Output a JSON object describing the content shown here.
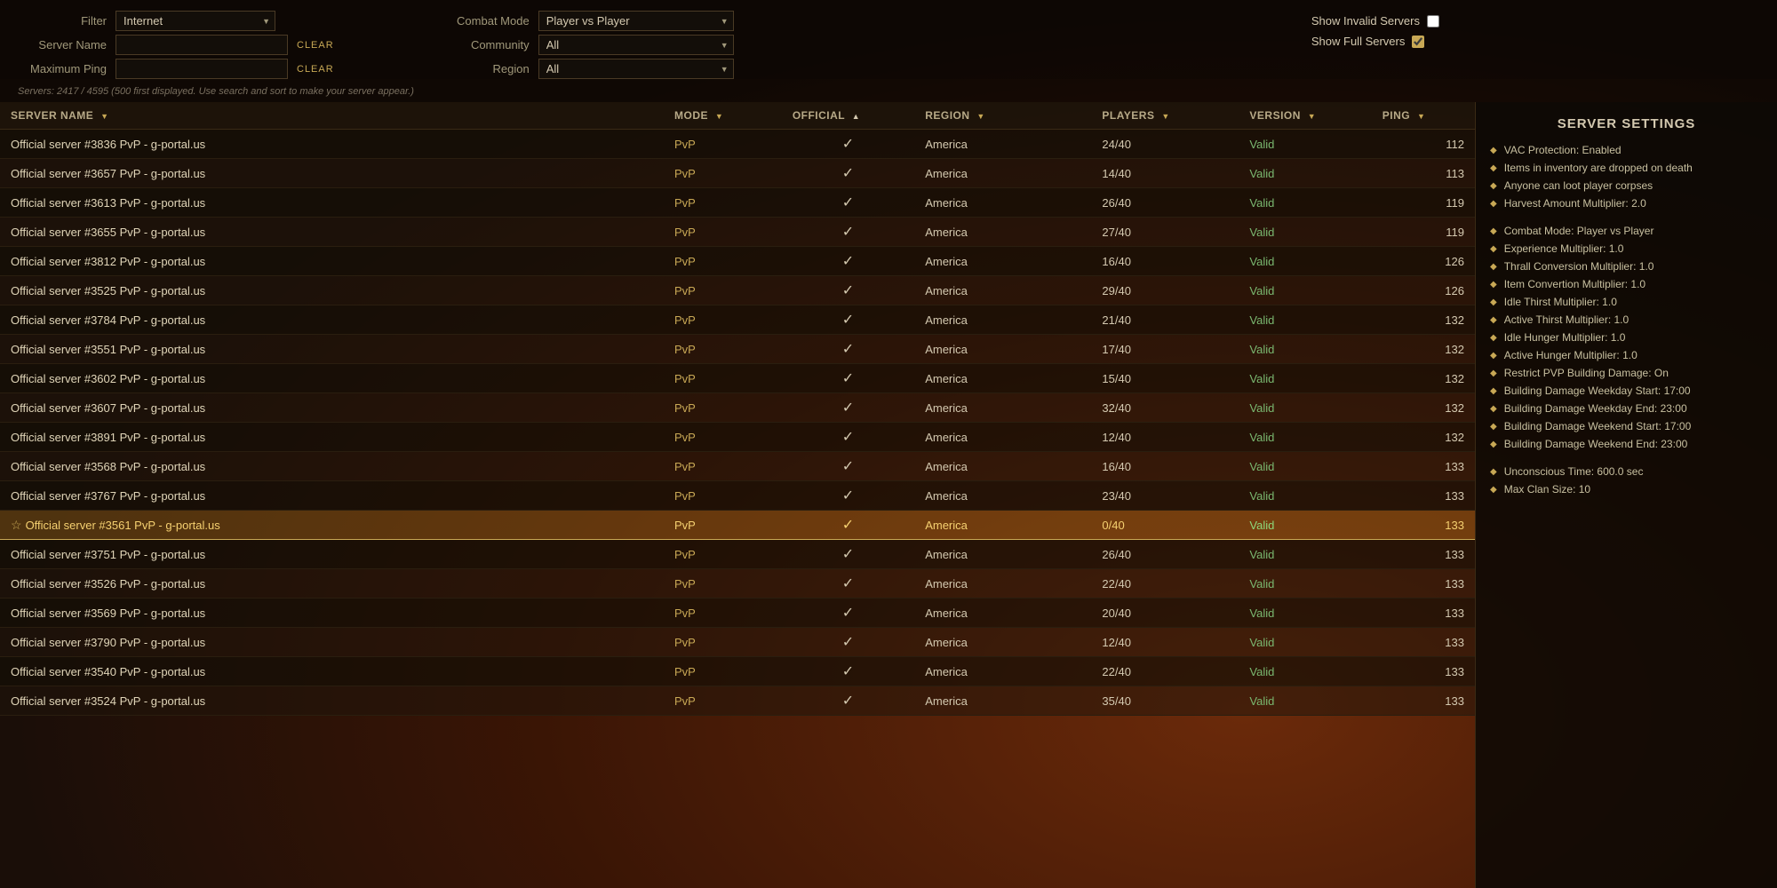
{
  "filters": {
    "filter_label": "Filter",
    "filter_value": "Internet",
    "server_name_label": "Server Name",
    "server_name_placeholder": "",
    "server_name_clear": "CLEAR",
    "max_ping_label": "Maximum Ping",
    "max_ping_placeholder": "",
    "max_ping_clear": "CLEAR",
    "combat_mode_label": "Combat Mode",
    "combat_mode_value": "Player vs Player",
    "community_label": "Community",
    "community_value": "All",
    "region_label": "Region",
    "region_value": "All",
    "show_invalid_label": "Show Invalid Servers",
    "show_full_label": "Show Full Servers",
    "show_invalid_checked": false,
    "show_full_checked": true
  },
  "server_count": {
    "text": "Servers: 2417 / 4595 (500 first displayed. Use search and sort to make your server appear.)"
  },
  "table": {
    "headers": [
      {
        "label": "SERVER NAME",
        "sort": "▼",
        "col": "server-name"
      },
      {
        "label": "MODE",
        "sort": "▼",
        "col": "mode"
      },
      {
        "label": "OFFICIAL",
        "sort": "▲",
        "col": "official"
      },
      {
        "label": "REGION",
        "sort": "▼",
        "col": "region"
      },
      {
        "label": "PLAYERS",
        "sort": "▼",
        "col": "players"
      },
      {
        "label": "VERSION",
        "sort": "▼",
        "col": "version"
      },
      {
        "label": "PING",
        "sort": "▼",
        "col": "ping"
      }
    ],
    "rows": [
      {
        "name": "Official server #3836 PvP - g-portal.us",
        "mode": "PvP",
        "official": "✓",
        "region": "America",
        "players": "24/40",
        "version": "Valid",
        "ping": "112",
        "selected": false,
        "star": false
      },
      {
        "name": "Official server #3657 PvP - g-portal.us",
        "mode": "PvP",
        "official": "✓",
        "region": "America",
        "players": "14/40",
        "version": "Valid",
        "ping": "113",
        "selected": false,
        "star": false
      },
      {
        "name": "Official server #3613 PvP - g-portal.us",
        "mode": "PvP",
        "official": "✓",
        "region": "America",
        "players": "26/40",
        "version": "Valid",
        "ping": "119",
        "selected": false,
        "star": false
      },
      {
        "name": "Official server #3655 PvP - g-portal.us",
        "mode": "PvP",
        "official": "✓",
        "region": "America",
        "players": "27/40",
        "version": "Valid",
        "ping": "119",
        "selected": false,
        "star": false
      },
      {
        "name": "Official server #3812 PvP - g-portal.us",
        "mode": "PvP",
        "official": "✓",
        "region": "America",
        "players": "16/40",
        "version": "Valid",
        "ping": "126",
        "selected": false,
        "star": false
      },
      {
        "name": "Official server #3525 PvP - g-portal.us",
        "mode": "PvP",
        "official": "✓",
        "region": "America",
        "players": "29/40",
        "version": "Valid",
        "ping": "126",
        "selected": false,
        "star": false
      },
      {
        "name": "Official server #3784 PvP - g-portal.us",
        "mode": "PvP",
        "official": "✓",
        "region": "America",
        "players": "21/40",
        "version": "Valid",
        "ping": "132",
        "selected": false,
        "star": false
      },
      {
        "name": "Official server #3551 PvP - g-portal.us",
        "mode": "PvP",
        "official": "✓",
        "region": "America",
        "players": "17/40",
        "version": "Valid",
        "ping": "132",
        "selected": false,
        "star": false
      },
      {
        "name": "Official server #3602 PvP - g-portal.us",
        "mode": "PvP",
        "official": "✓",
        "region": "America",
        "players": "15/40",
        "version": "Valid",
        "ping": "132",
        "selected": false,
        "star": false
      },
      {
        "name": "Official server #3607 PvP - g-portal.us",
        "mode": "PvP",
        "official": "✓",
        "region": "America",
        "players": "32/40",
        "version": "Valid",
        "ping": "132",
        "selected": false,
        "star": false
      },
      {
        "name": "Official server #3891 PvP - g-portal.us",
        "mode": "PvP",
        "official": "✓",
        "region": "America",
        "players": "12/40",
        "version": "Valid",
        "ping": "132",
        "selected": false,
        "star": false
      },
      {
        "name": "Official server #3568 PvP - g-portal.us",
        "mode": "PvP",
        "official": "✓",
        "region": "America",
        "players": "16/40",
        "version": "Valid",
        "ping": "133",
        "selected": false,
        "star": false
      },
      {
        "name": "Official server #3767 PvP - g-portal.us",
        "mode": "PvP",
        "official": "✓",
        "region": "America",
        "players": "23/40",
        "version": "Valid",
        "ping": "133",
        "selected": false,
        "star": false
      },
      {
        "name": "Official server #3561 PvP - g-portal.us",
        "mode": "PvP",
        "official": "✓",
        "region": "America",
        "players": "0/40",
        "version": "Valid",
        "ping": "133",
        "selected": true,
        "star": true
      },
      {
        "name": "Official server #3751 PvP - g-portal.us",
        "mode": "PvP",
        "official": "✓",
        "region": "America",
        "players": "26/40",
        "version": "Valid",
        "ping": "133",
        "selected": false,
        "star": false
      },
      {
        "name": "Official server #3526 PvP - g-portal.us",
        "mode": "PvP",
        "official": "✓",
        "region": "America",
        "players": "22/40",
        "version": "Valid",
        "ping": "133",
        "selected": false,
        "star": false
      },
      {
        "name": "Official server #3569 PvP - g-portal.us",
        "mode": "PvP",
        "official": "✓",
        "region": "America",
        "players": "20/40",
        "version": "Valid",
        "ping": "133",
        "selected": false,
        "star": false
      },
      {
        "name": "Official server #3790 PvP - g-portal.us",
        "mode": "PvP",
        "official": "✓",
        "region": "America",
        "players": "12/40",
        "version": "Valid",
        "ping": "133",
        "selected": false,
        "star": false
      },
      {
        "name": "Official server #3540 PvP - g-portal.us",
        "mode": "PvP",
        "official": "✓",
        "region": "America",
        "players": "22/40",
        "version": "Valid",
        "ping": "133",
        "selected": false,
        "star": false
      },
      {
        "name": "Official server #3524 PvP - g-portal.us",
        "mode": "PvP",
        "official": "✓",
        "region": "America",
        "players": "35/40",
        "version": "Valid",
        "ping": "133",
        "selected": false,
        "star": false
      }
    ]
  },
  "settings": {
    "title": "SERVER SETTINGS",
    "items": [
      {
        "text": "VAC Protection: Enabled",
        "group": 1
      },
      {
        "text": "Items in inventory are dropped on death",
        "group": 1
      },
      {
        "text": "Anyone can loot player corpses",
        "group": 1
      },
      {
        "text": "Harvest Amount Multiplier: 2.0",
        "group": 1
      },
      {
        "text": "Combat Mode: Player vs Player",
        "group": 2
      },
      {
        "text": "Experience Multiplier: 1.0",
        "group": 2
      },
      {
        "text": "Thrall Conversion Multiplier: 1.0",
        "group": 2
      },
      {
        "text": "Item Convertion Multiplier: 1.0",
        "group": 2
      },
      {
        "text": "Idle Thirst Multiplier: 1.0",
        "group": 2
      },
      {
        "text": "Active Thirst Multiplier: 1.0",
        "group": 2
      },
      {
        "text": "Idle Hunger Multiplier: 1.0",
        "group": 2
      },
      {
        "text": "Active Hunger Multiplier: 1.0",
        "group": 2
      },
      {
        "text": "Restrict PVP Building Damage: On",
        "group": 2
      },
      {
        "text": "Building Damage Weekday Start: 17:00",
        "group": 2
      },
      {
        "text": "Building Damage Weekday End: 23:00",
        "group": 2
      },
      {
        "text": "Building Damage Weekend Start: 17:00",
        "group": 2
      },
      {
        "text": "Building Damage Weekend End: 23:00",
        "group": 2
      },
      {
        "text": "Unconscious Time: 600.0 sec",
        "group": 3
      },
      {
        "text": "Max Clan Size: 10",
        "group": 3
      }
    ]
  }
}
